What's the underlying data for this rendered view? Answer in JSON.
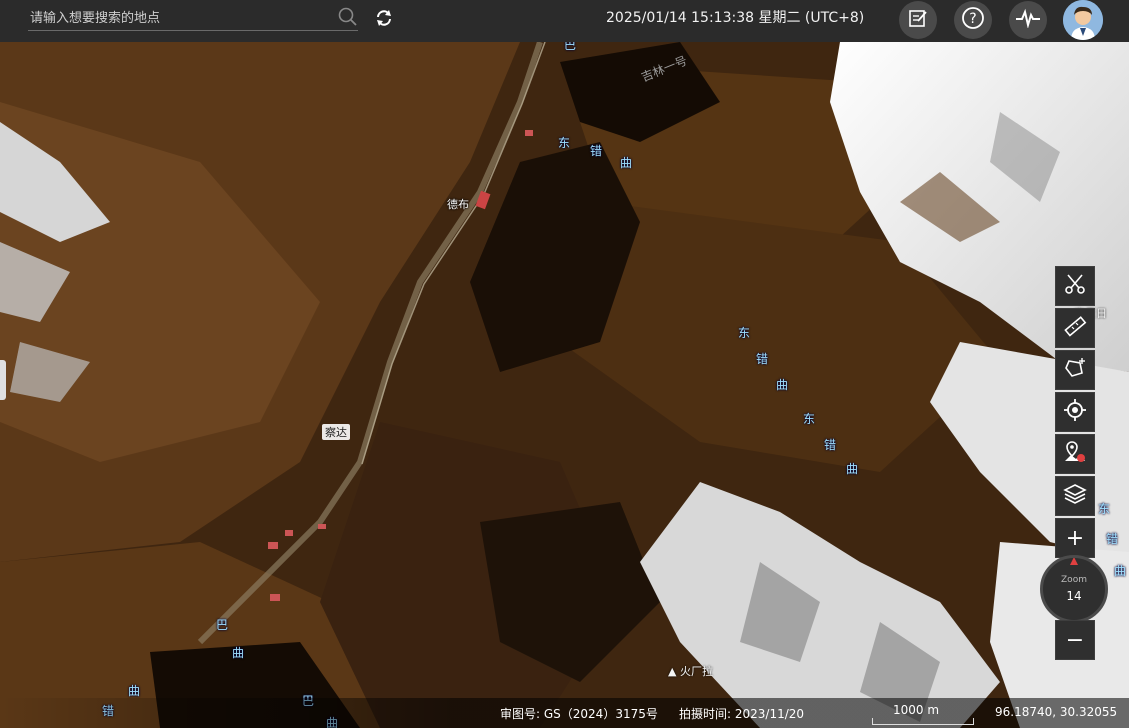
{
  "search": {
    "placeholder": "请输入想要搜索的地点",
    "value": ""
  },
  "header": {
    "datetime": "2025/01/14 15:13:38 星期二 (UTC+8)"
  },
  "icons": {
    "search": "search-icon",
    "refresh": "refresh-icon",
    "edit": "edit-icon",
    "help": "help-icon",
    "pulse": "pulse-icon",
    "avatar": "avatar"
  },
  "map": {
    "place_labels": [
      "吉林一号",
      "德布",
      "察达",
      "察贡日",
      "火厂拉"
    ],
    "road_label_chars": [
      "东",
      "错",
      "曲",
      "东",
      "错",
      "曲",
      "东",
      "错",
      "曲",
      "东",
      "错",
      "曲",
      "巴",
      "曲",
      "巴",
      "曲",
      "错",
      "曲",
      "巴",
      "曲"
    ]
  },
  "toolbar": {
    "tools": [
      "cut-icon",
      "ruler-icon",
      "polygon-icon",
      "locate-icon",
      "marker-icon",
      "layers-icon"
    ],
    "zoom_in": "+",
    "zoom_out": "−",
    "zoom_label": "Zoom",
    "zoom_value": "14"
  },
  "footer": {
    "approval": "审图号:  GS（2024）3175号",
    "capture": "拍摄时间:  2023/11/20",
    "scale": "1000 m",
    "coords": "96.18740, 30.32055"
  },
  "colors": {
    "topbar": "#2b2b2b",
    "road_label": "#9fe0ff",
    "snow": "#f2f2f2",
    "terrain": "#4a2e14"
  }
}
